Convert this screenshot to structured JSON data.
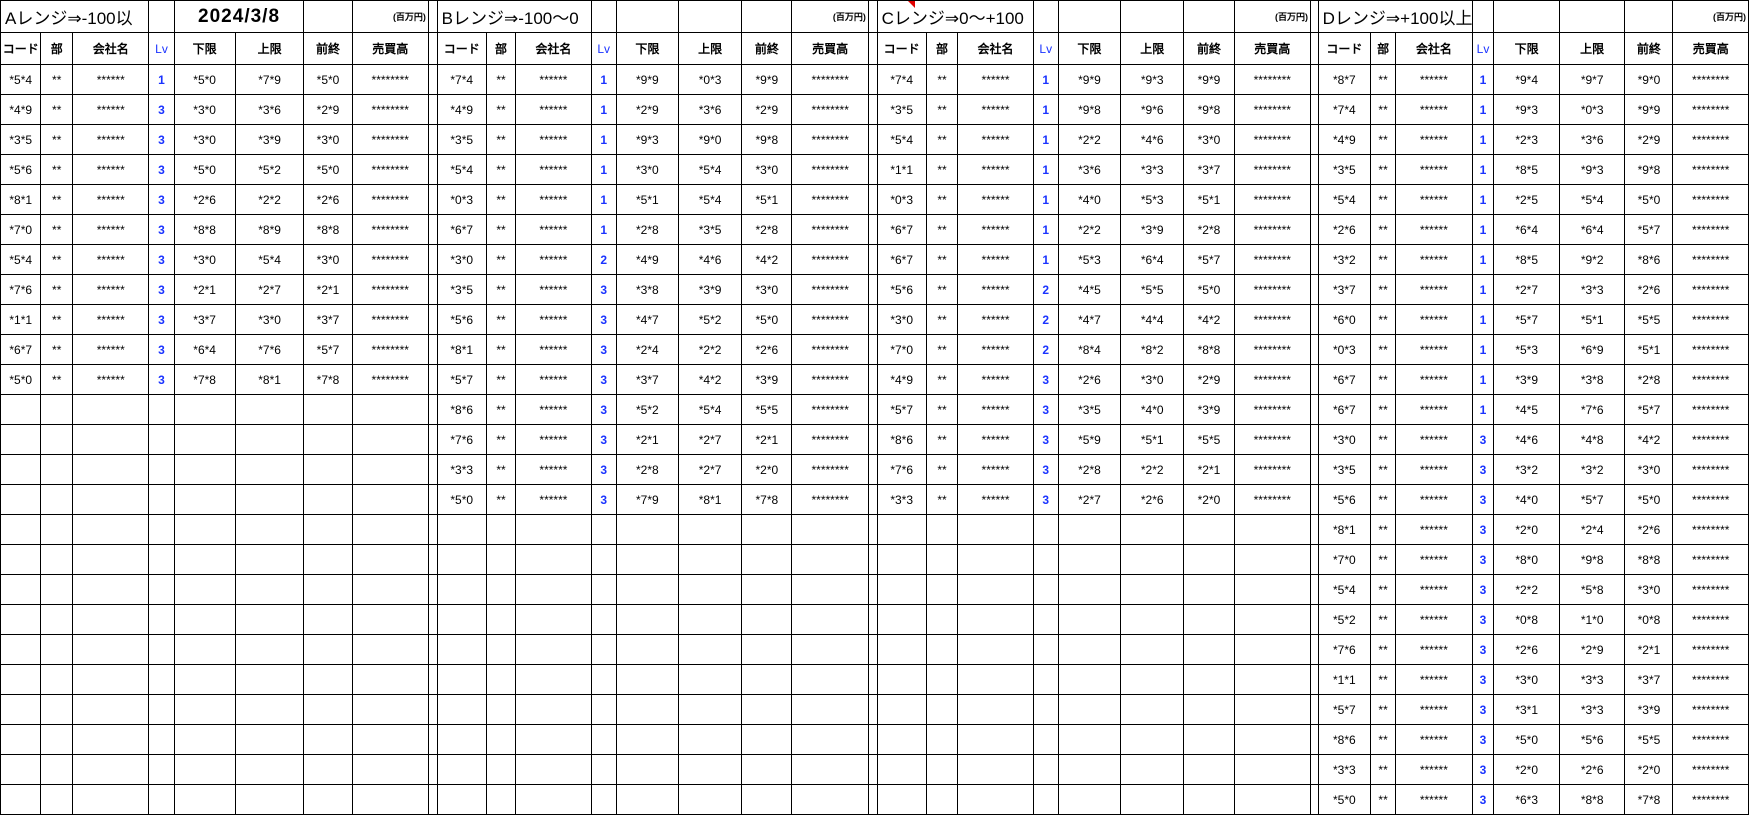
{
  "date": "2024/3/8",
  "unit_label": "(百万円)",
  "headers": {
    "code": "コード",
    "dept": "部",
    "name": "会社名",
    "lv": "Lv",
    "low": "下限",
    "high": "上限",
    "prev": "前終",
    "sales": "売買高"
  },
  "ranges": [
    {
      "title": "Aレンジ⇒-100以",
      "rows": [
        [
          "*5*4",
          "**",
          "******",
          "1",
          "*5*0",
          "*7*9",
          "*5*0",
          "********"
        ],
        [
          "*4*9",
          "**",
          "******",
          "3",
          "*3*0",
          "*3*6",
          "*2*9",
          "********"
        ],
        [
          "*3*5",
          "**",
          "******",
          "3",
          "*3*0",
          "*3*9",
          "*3*0",
          "********"
        ],
        [
          "*5*6",
          "**",
          "******",
          "3",
          "*5*0",
          "*5*2",
          "*5*0",
          "********"
        ],
        [
          "*8*1",
          "**",
          "******",
          "3",
          "*2*6",
          "*2*2",
          "*2*6",
          "********"
        ],
        [
          "*7*0",
          "**",
          "******",
          "3",
          "*8*8",
          "*8*9",
          "*8*8",
          "********"
        ],
        [
          "*5*4",
          "**",
          "******",
          "3",
          "*3*0",
          "*5*4",
          "*3*0",
          "********"
        ],
        [
          "*7*6",
          "**",
          "******",
          "3",
          "*2*1",
          "*2*7",
          "*2*1",
          "********"
        ],
        [
          "*1*1",
          "**",
          "******",
          "3",
          "*3*7",
          "*3*0",
          "*3*7",
          "********"
        ],
        [
          "*6*7",
          "**",
          "******",
          "3",
          "*6*4",
          "*7*6",
          "*5*7",
          "********"
        ],
        [
          "*5*0",
          "**",
          "******",
          "3",
          "*7*8",
          "*8*1",
          "*7*8",
          "********"
        ]
      ]
    },
    {
      "title": "Bレンジ⇒-100〜0",
      "rows": [
        [
          "*7*4",
          "**",
          "******",
          "1",
          "*9*9",
          "*0*3",
          "*9*9",
          "********"
        ],
        [
          "*4*9",
          "**",
          "******",
          "1",
          "*2*9",
          "*3*6",
          "*2*9",
          "********"
        ],
        [
          "*3*5",
          "**",
          "******",
          "1",
          "*9*3",
          "*9*0",
          "*9*8",
          "********"
        ],
        [
          "*5*4",
          "**",
          "******",
          "1",
          "*3*0",
          "*5*4",
          "*3*0",
          "********"
        ],
        [
          "*0*3",
          "**",
          "******",
          "1",
          "*5*1",
          "*5*4",
          "*5*1",
          "********"
        ],
        [
          "*6*7",
          "**",
          "******",
          "1",
          "*2*8",
          "*3*5",
          "*2*8",
          "********"
        ],
        [
          "*3*0",
          "**",
          "******",
          "2",
          "*4*9",
          "*4*6",
          "*4*2",
          "********"
        ],
        [
          "*3*5",
          "**",
          "******",
          "3",
          "*3*8",
          "*3*9",
          "*3*0",
          "********"
        ],
        [
          "*5*6",
          "**",
          "******",
          "3",
          "*4*7",
          "*5*2",
          "*5*0",
          "********"
        ],
        [
          "*8*1",
          "**",
          "******",
          "3",
          "*2*4",
          "*2*2",
          "*2*6",
          "********"
        ],
        [
          "*5*7",
          "**",
          "******",
          "3",
          "*3*7",
          "*4*2",
          "*3*9",
          "********"
        ],
        [
          "*8*6",
          "**",
          "******",
          "3",
          "*5*2",
          "*5*4",
          "*5*5",
          "********"
        ],
        [
          "*7*6",
          "**",
          "******",
          "3",
          "*2*1",
          "*2*7",
          "*2*1",
          "********"
        ],
        [
          "*3*3",
          "**",
          "******",
          "3",
          "*2*8",
          "*2*7",
          "*2*0",
          "********"
        ],
        [
          "*5*0",
          "**",
          "******",
          "3",
          "*7*9",
          "*8*1",
          "*7*8",
          "********"
        ]
      ]
    },
    {
      "title": "Cレンジ⇒0〜+100",
      "rows": [
        [
          "*7*4",
          "**",
          "******",
          "1",
          "*9*9",
          "*9*3",
          "*9*9",
          "********"
        ],
        [
          "*3*5",
          "**",
          "******",
          "1",
          "*9*8",
          "*9*6",
          "*9*8",
          "********"
        ],
        [
          "*5*4",
          "**",
          "******",
          "1",
          "*2*2",
          "*4*6",
          "*3*0",
          "********"
        ],
        [
          "*1*1",
          "**",
          "******",
          "1",
          "*3*6",
          "*3*3",
          "*3*7",
          "********"
        ],
        [
          "*0*3",
          "**",
          "******",
          "1",
          "*4*0",
          "*5*3",
          "*5*1",
          "********"
        ],
        [
          "*6*7",
          "**",
          "******",
          "1",
          "*2*2",
          "*3*9",
          "*2*8",
          "********"
        ],
        [
          "*6*7",
          "**",
          "******",
          "1",
          "*5*3",
          "*6*4",
          "*5*7",
          "********"
        ],
        [
          "*5*6",
          "**",
          "******",
          "2",
          "*4*5",
          "*5*5",
          "*5*0",
          "********"
        ],
        [
          "*3*0",
          "**",
          "******",
          "2",
          "*4*7",
          "*4*4",
          "*4*2",
          "********"
        ],
        [
          "*7*0",
          "**",
          "******",
          "2",
          "*8*4",
          "*8*2",
          "*8*8",
          "********"
        ],
        [
          "*4*9",
          "**",
          "******",
          "3",
          "*2*6",
          "*3*0",
          "*2*9",
          "********"
        ],
        [
          "*5*7",
          "**",
          "******",
          "3",
          "*3*5",
          "*4*0",
          "*3*9",
          "********"
        ],
        [
          "*8*6",
          "**",
          "******",
          "3",
          "*5*9",
          "*5*1",
          "*5*5",
          "********"
        ],
        [
          "*7*6",
          "**",
          "******",
          "3",
          "*2*8",
          "*2*2",
          "*2*1",
          "********"
        ],
        [
          "*3*3",
          "**",
          "******",
          "3",
          "*2*7",
          "*2*6",
          "*2*0",
          "********"
        ]
      ]
    },
    {
      "title": "Dレンジ⇒+100以上",
      "rows": [
        [
          "*8*7",
          "**",
          "******",
          "1",
          "*9*4",
          "*9*7",
          "*9*0",
          "********"
        ],
        [
          "*7*4",
          "**",
          "******",
          "1",
          "*9*3",
          "*0*3",
          "*9*9",
          "********"
        ],
        [
          "*4*9",
          "**",
          "******",
          "1",
          "*2*3",
          "*3*6",
          "*2*9",
          "********"
        ],
        [
          "*3*5",
          "**",
          "******",
          "1",
          "*8*5",
          "*9*3",
          "*9*8",
          "********"
        ],
        [
          "*5*4",
          "**",
          "******",
          "1",
          "*2*5",
          "*5*4",
          "*5*0",
          "********"
        ],
        [
          "*2*6",
          "**",
          "******",
          "1",
          "*6*4",
          "*6*4",
          "*5*7",
          "********"
        ],
        [
          "*3*2",
          "**",
          "******",
          "1",
          "*8*5",
          "*9*2",
          "*8*6",
          "********"
        ],
        [
          "*3*7",
          "**",
          "******",
          "1",
          "*2*7",
          "*3*3",
          "*2*6",
          "********"
        ],
        [
          "*6*0",
          "**",
          "******",
          "1",
          "*5*7",
          "*5*1",
          "*5*5",
          "********"
        ],
        [
          "*0*3",
          "**",
          "******",
          "1",
          "*5*3",
          "*6*9",
          "*5*1",
          "********"
        ],
        [
          "*6*7",
          "**",
          "******",
          "1",
          "*3*9",
          "*3*8",
          "*2*8",
          "********"
        ],
        [
          "*6*7",
          "**",
          "******",
          "1",
          "*4*5",
          "*7*6",
          "*5*7",
          "********"
        ],
        [
          "*3*0",
          "**",
          "******",
          "3",
          "*4*6",
          "*4*8",
          "*4*2",
          "********"
        ],
        [
          "*3*5",
          "**",
          "******",
          "3",
          "*3*2",
          "*3*2",
          "*3*0",
          "********"
        ],
        [
          "*5*6",
          "**",
          "******",
          "3",
          "*4*0",
          "*5*7",
          "*5*0",
          "********"
        ],
        [
          "*8*1",
          "**",
          "******",
          "3",
          "*2*0",
          "*2*4",
          "*2*6",
          "********"
        ],
        [
          "*7*0",
          "**",
          "******",
          "3",
          "*8*0",
          "*9*8",
          "*8*8",
          "********"
        ],
        [
          "*5*4",
          "**",
          "******",
          "3",
          "*2*2",
          "*5*8",
          "*3*0",
          "********"
        ],
        [
          "*5*2",
          "**",
          "******",
          "3",
          "*0*8",
          "*1*0",
          "*0*8",
          "********"
        ],
        [
          "*7*6",
          "**",
          "******",
          "3",
          "*2*6",
          "*2*9",
          "*2*1",
          "********"
        ],
        [
          "*1*1",
          "**",
          "******",
          "3",
          "*3*0",
          "*3*3",
          "*3*7",
          "********"
        ],
        [
          "*5*7",
          "**",
          "******",
          "3",
          "*3*1",
          "*3*3",
          "*3*9",
          "********"
        ],
        [
          "*8*6",
          "**",
          "******",
          "3",
          "*5*0",
          "*5*6",
          "*5*5",
          "********"
        ],
        [
          "*3*3",
          "**",
          "******",
          "3",
          "*2*0",
          "*2*6",
          "*2*0",
          "********"
        ],
        [
          "*5*0",
          "**",
          "******",
          "3",
          "*6*3",
          "*8*8",
          "*7*8",
          "********"
        ]
      ]
    }
  ],
  "total_data_rows": 25
}
